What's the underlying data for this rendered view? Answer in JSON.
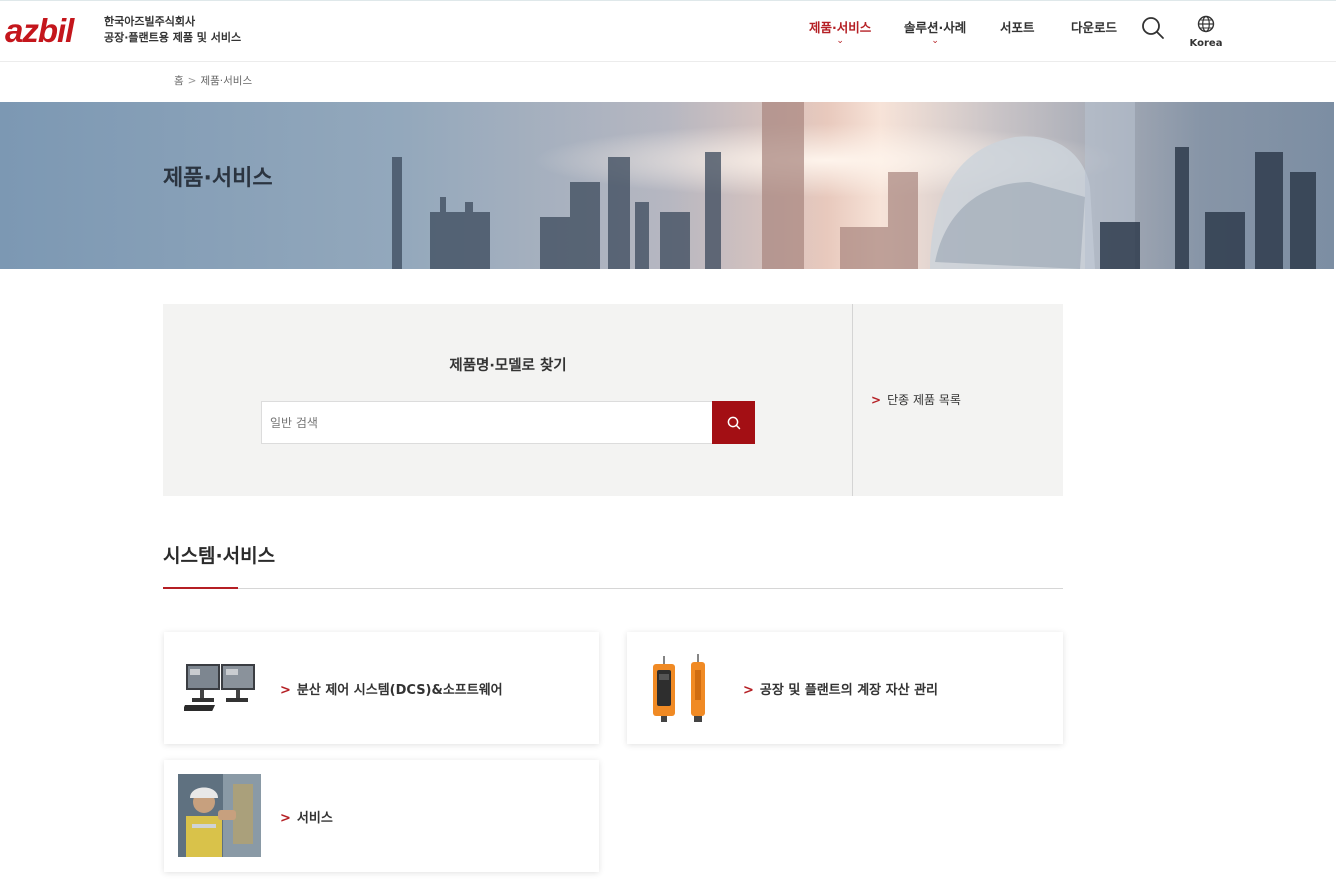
{
  "header": {
    "logo": "azbil",
    "company_line1": "한국아즈빌주식회사",
    "company_line2": "공장·플랜트용 제품 및 서비스",
    "nav": [
      {
        "label": "제품·서비스",
        "active": true,
        "has_dropdown": true
      },
      {
        "label": "솔루션·사례",
        "active": false,
        "has_dropdown": true
      },
      {
        "label": "서포트",
        "active": false,
        "has_dropdown": false
      },
      {
        "label": "다운로드",
        "active": false,
        "has_dropdown": false
      }
    ],
    "search_icon": "search-icon",
    "region_icon": "globe-icon",
    "region_label": "Korea"
  },
  "breadcrumb": {
    "home": "홈",
    "current": "제품·서비스"
  },
  "hero": {
    "title": "제품·서비스"
  },
  "search": {
    "title": "제품명·모델로 찾기",
    "placeholder": "일반 검색",
    "button_icon": "search-icon",
    "side_link": "단종 제품 목록"
  },
  "section": {
    "title": "시스템·서비스",
    "cards": [
      {
        "label": "분산 제어 시스템(DCS)&소프트웨어",
        "image": "dcs-monitors-image"
      },
      {
        "label": "공장 및 플랜트의 계장 자산 관리",
        "image": "field-communicator-image"
      },
      {
        "label": "서비스",
        "image": "service-technician-image"
      }
    ]
  },
  "colors": {
    "brand_red": "#c4161c",
    "button_red": "#a30f14",
    "panel_gray": "#f3f3f2"
  }
}
